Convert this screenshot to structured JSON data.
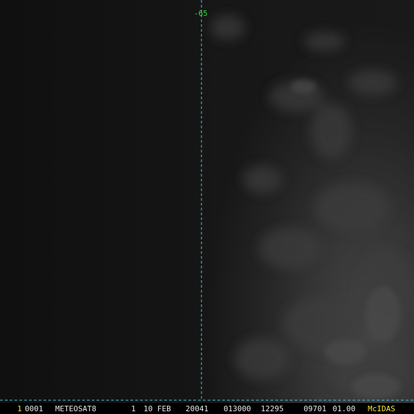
{
  "colors": {
    "grid_line": "#4fc3e6",
    "lon_label": "#33e044",
    "status_text": "#e8e8e8",
    "brand_text": "#f2e43a",
    "frame_num": "#f2e43a"
  },
  "grid": {
    "meridian_label": "-65"
  },
  "status_bar": {
    "frame_number": "1",
    "band": "0001",
    "satellite": "METEOSAT8",
    "day": "1",
    "date": "10 FEB",
    "julian": "20041",
    "time": "013000",
    "line_elem": "12295",
    "resolution": "09701",
    "magnification": "01.00",
    "brand": "McIDAS"
  }
}
